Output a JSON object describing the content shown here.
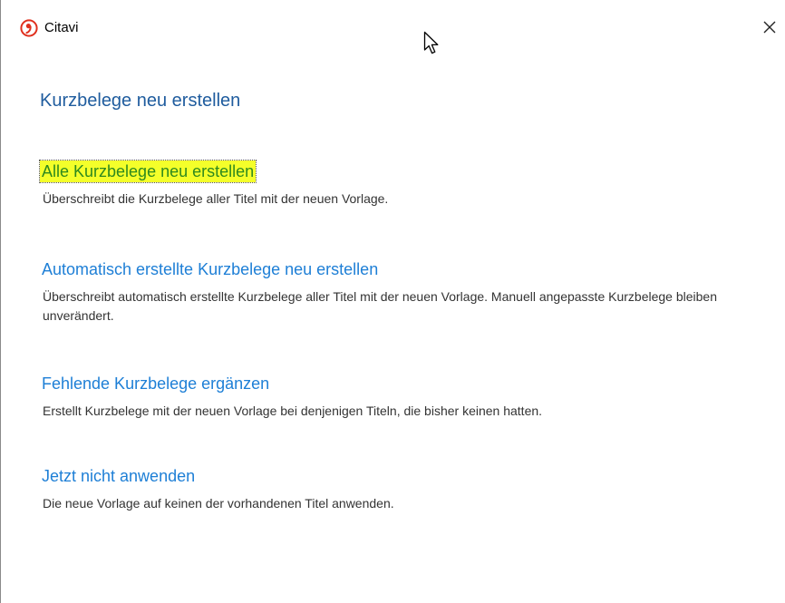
{
  "window": {
    "app_name": "Citavi",
    "app_icon": "citavi-logo-icon",
    "close_icon": "close-icon"
  },
  "dialog": {
    "heading": "Kurzbelege neu erstellen",
    "options": [
      {
        "label": "Alle Kurzbelege neu erstellen",
        "description": "Überschreibt die Kurzbelege aller Titel mit der neuen Vorlage.",
        "highlighted": true
      },
      {
        "label": "Automatisch erstellte Kurzbelege neu erstellen",
        "description": "Überschreibt automatisch erstellte Kurzbelege aller Titel mit der neuen Vorlage. Manuell angepasste Kurzbelege bleiben unverändert.",
        "highlighted": false
      },
      {
        "label": "Fehlende Kurzbelege ergänzen",
        "description": "Erstellt Kurzbelege mit der neuen Vorlage bei denjenigen Titeln, die bisher keinen hatten.",
        "highlighted": false
      },
      {
        "label": "Jetzt nicht anwenden",
        "description": "Die neue Vorlage auf keinen der vorhandenen Titel anwenden.",
        "highlighted": false
      }
    ]
  },
  "colors": {
    "heading": "#1f5c9e",
    "link": "#1e7fd6",
    "highlight_bg": "#f4ff2a",
    "highlight_text": "#2f8a1e",
    "logo": "#e0301e"
  }
}
